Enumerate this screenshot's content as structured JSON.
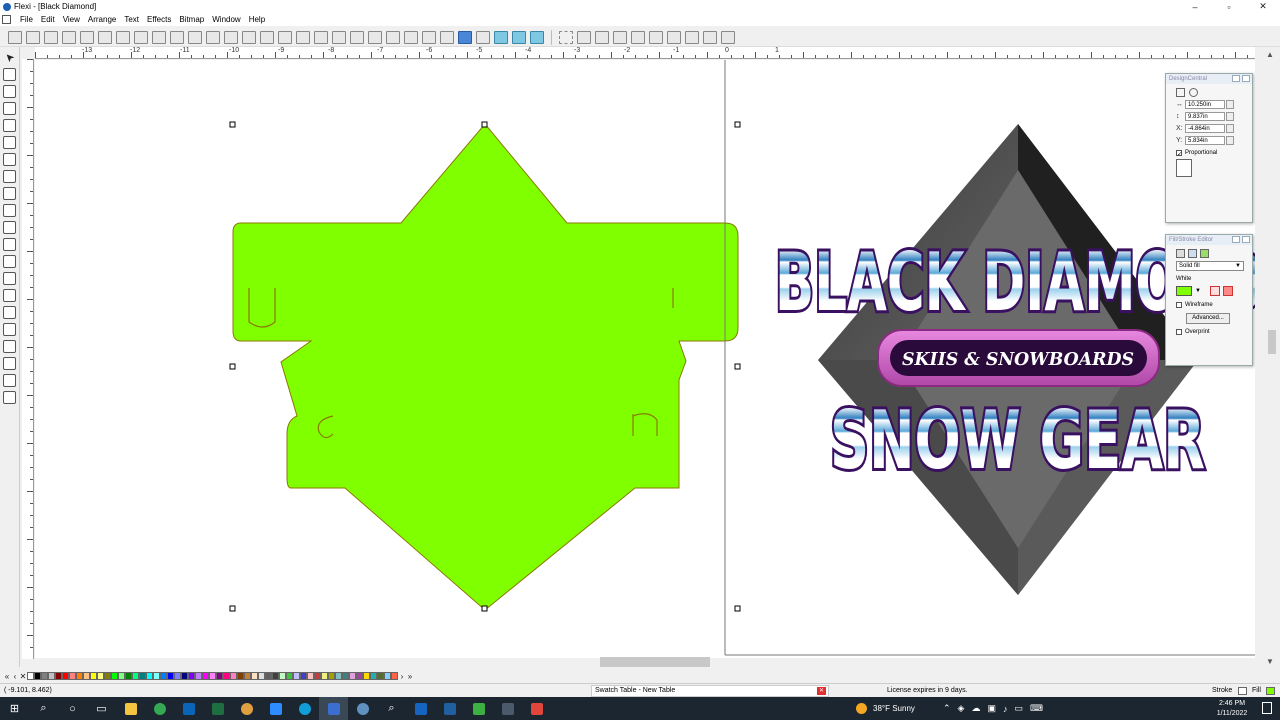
{
  "window": {
    "title": "Flexi - [Black Diamond]",
    "buttons": [
      "–",
      "▫",
      "✕"
    ]
  },
  "menu": [
    "File",
    "Edit",
    "View",
    "Arrange",
    "Text",
    "Effects",
    "Bitmap",
    "Window",
    "Help"
  ],
  "ruler": {
    "labels": [
      "-13",
      "-12",
      "-11",
      "-10",
      "-9",
      "-8",
      "-7",
      "-6",
      "-5",
      "-4",
      "-3",
      "-2",
      "-1",
      "0",
      "1"
    ]
  },
  "artwork": {
    "line1": "BLACK DIAMOND",
    "badge": "SKIIS & SNOWBOARDS",
    "line2": "SNOW GEAR"
  },
  "design_central": {
    "title": "DesignCentral",
    "width": "10.250in",
    "height": "9.837in",
    "x_label": "X:",
    "x": "-4.864in",
    "y_label": "Y:",
    "y": "5.834in",
    "proportional": "Proportional"
  },
  "fill_stroke": {
    "title": "Fill/Stroke Editor",
    "fill_type": "Solid fill",
    "color_name": "White",
    "wireframe": "Wireframe",
    "advanced": "Advanced...",
    "overprint": "Overprint"
  },
  "status": {
    "coords": "( -9.101,  8.462)",
    "swatch_table": "Swatch Table - New Table",
    "license": "License expires in 9 days.",
    "stroke_label": "Stroke",
    "fill_label": "Fill"
  },
  "taskbar": {
    "weather": "38°F  Sunny",
    "time": "2:46 PM",
    "date": "1/11/2022"
  },
  "colors": {
    "fill_green": "#80ff00",
    "outline": "#8a7a00",
    "stripe_dark": "#1a3a6a",
    "text_outline": "#3a1060",
    "badge_pink": "#d35ec8"
  },
  "palette": [
    "#ffffff",
    "#000000",
    "#7f7f7f",
    "#c0c0c0",
    "#880000",
    "#ff0000",
    "#ff8080",
    "#ff8000",
    "#ffc080",
    "#ffff00",
    "#ffff80",
    "#808000",
    "#00ff00",
    "#80ff80",
    "#008000",
    "#00ff80",
    "#008080",
    "#00ffff",
    "#80ffff",
    "#0080ff",
    "#0000ff",
    "#8080ff",
    "#000080",
    "#8000ff",
    "#c080ff",
    "#ff00ff",
    "#ff80ff",
    "#800080",
    "#ff0080",
    "#ff80c0",
    "#804000",
    "#c08040",
    "#ffe0c0",
    "#e0e0e0",
    "#606060",
    "#404040",
    "#c0ffc0",
    "#40c040",
    "#c0c0ff",
    "#4040c0",
    "#ffc0c0",
    "#c04040",
    "#f0f080",
    "#a0a000",
    "#80c0c0",
    "#408080",
    "#e0a0e0",
    "#a040a0",
    "#ffd700",
    "#20b2aa",
    "#556b2f",
    "#87cefa",
    "#ff6347"
  ]
}
